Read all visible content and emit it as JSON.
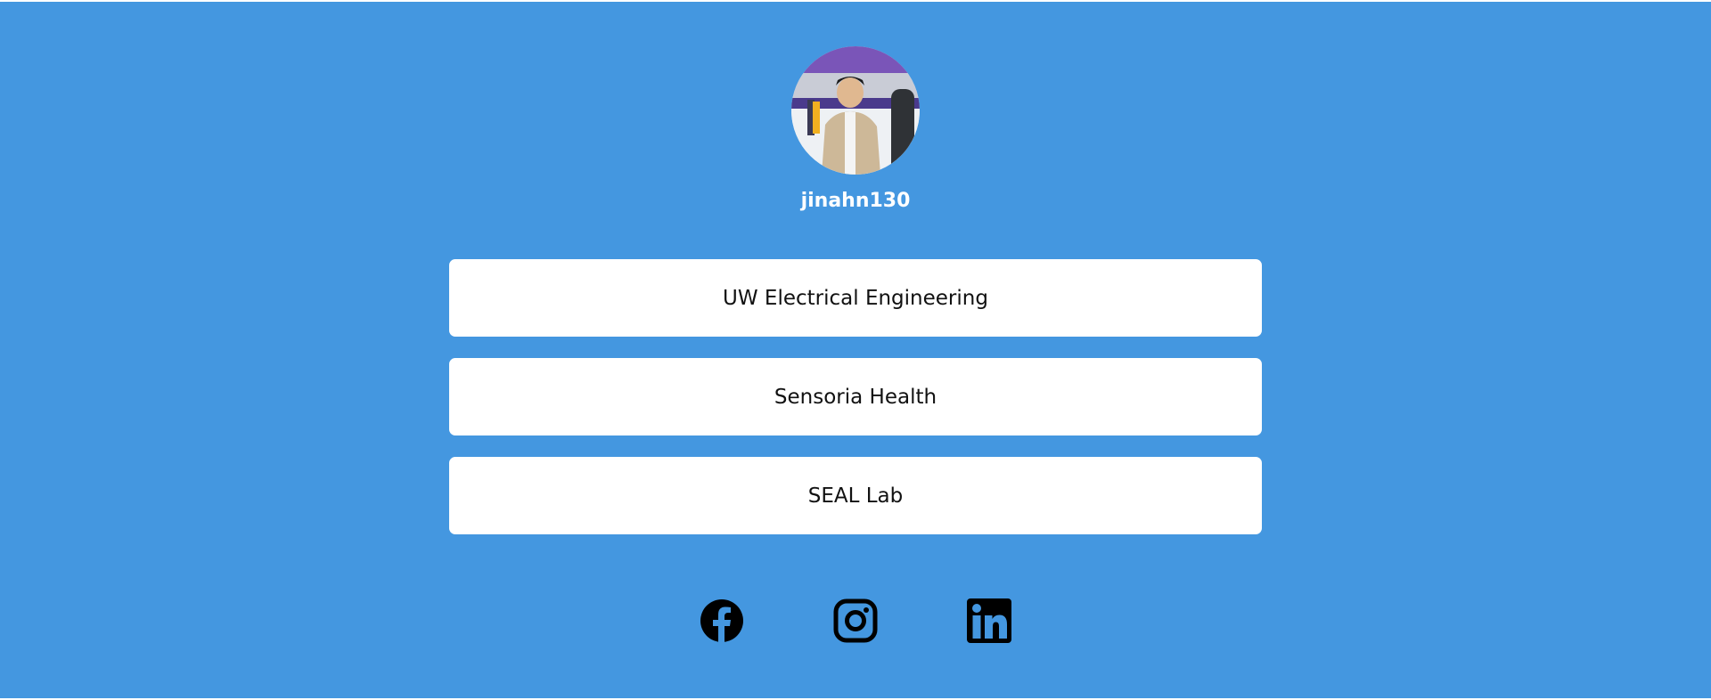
{
  "profile": {
    "username": "jinahn130",
    "avatar_icon": "profile-photo"
  },
  "links": [
    {
      "label": "UW Electrical Engineering"
    },
    {
      "label": "Sensoria Health"
    },
    {
      "label": "SEAL Lab"
    }
  ],
  "social": [
    {
      "name": "Facebook",
      "icon": "facebook-icon"
    },
    {
      "name": "Instagram",
      "icon": "instagram-icon"
    },
    {
      "name": "LinkedIn",
      "icon": "linkedin-icon"
    }
  ],
  "colors": {
    "background": "#4497e0",
    "button": "#ffffff",
    "button_text": "#111111",
    "icon": "#000000"
  }
}
